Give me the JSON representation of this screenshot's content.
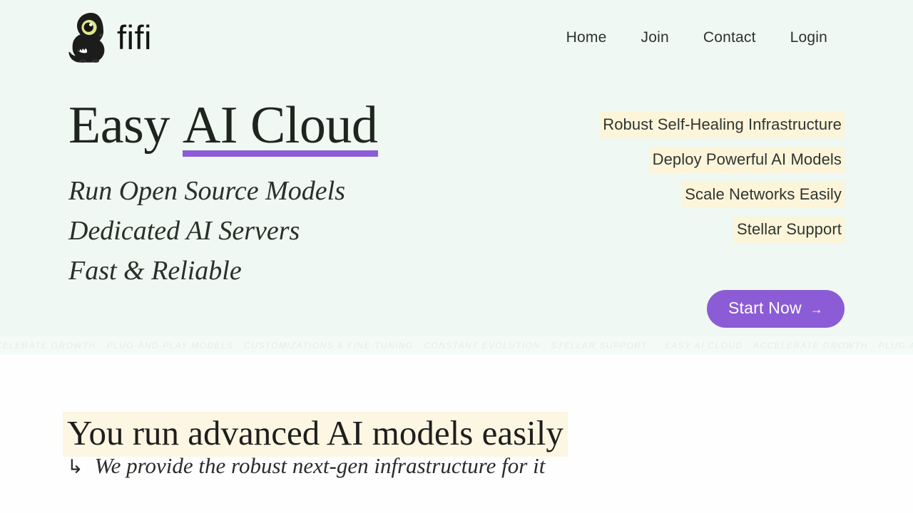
{
  "colors": {
    "hero_bg": "#eff8f2",
    "page_bg": "#fdfefd",
    "accent_purple": "#8b5cd6",
    "highlight_cream": "#fcf5da",
    "heading_highlight": "#fcf6e2",
    "marquee_text": "#ddf0e4",
    "text_dark": "#232323"
  },
  "header": {
    "brand_name": "fifi",
    "logo_icon": "dinosaur-mascot-icon",
    "nav": [
      {
        "label": "Home"
      },
      {
        "label": "Join"
      },
      {
        "label": "Contact"
      },
      {
        "label": "Login"
      }
    ]
  },
  "hero": {
    "headline_plain": "Easy ",
    "headline_underlined": "AI Cloud",
    "sub_lines": [
      "Run Open Source Models",
      "Dedicated AI Servers",
      "Fast & Reliable"
    ],
    "features": [
      "Robust Self-Healing Infrastructure",
      "Deploy Powerful AI Models",
      "Scale Networks Easily",
      "Stellar Support"
    ],
    "cta": {
      "label": "Start Now",
      "arrow": "→",
      "arrow_icon": "arrow-right-icon"
    }
  },
  "marquee": {
    "separator": " · ",
    "items": [
      "EASY AI CLOUD",
      "ACCELERATE GROWTH",
      "PLUG-AND-PLAY MODELS",
      "CUSTOMIZATIONS & FINE-TUNING",
      "CONSTANT EVOLUTION",
      "STELLAR SUPPORT"
    ],
    "chunk_text": "EASY AI CLOUD · ACCELERATE GROWTH · PLUG-AND-PLAY MODELS · CUSTOMIZATIONS & FINE-TUNING · CONSTANT EVOLUTION · STELLAR SUPPORT · "
  },
  "section_two": {
    "heading": "You run advanced AI models easily",
    "subline_arrow": "↳",
    "subline_arrow_icon": "arrow-turn-down-right-icon",
    "subline_text": "We provide the robust next-gen infrastructure for it"
  }
}
